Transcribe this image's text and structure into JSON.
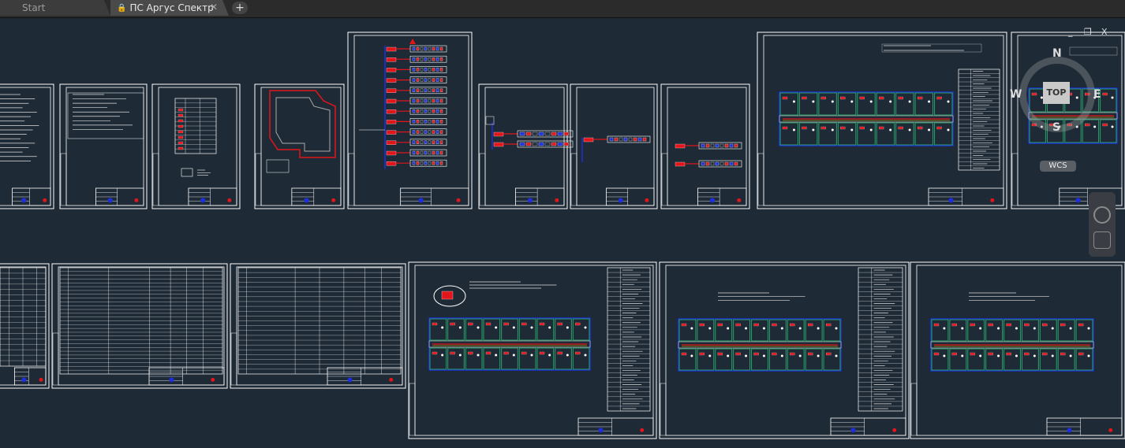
{
  "tabs": [
    {
      "label": "Start",
      "active": false
    },
    {
      "label": "ПС Аргус Спектр",
      "active": true
    }
  ],
  "new_tab_label": "+",
  "window_controls": {
    "minimize": "_",
    "restore": "❐",
    "close": "X"
  },
  "viewcube": {
    "face": "TOP",
    "north": "N",
    "south": "S",
    "east": "E",
    "west": "W"
  },
  "ucs_label": "WCS",
  "colors": {
    "background": "#1e2a36",
    "sheet": "#ffffff",
    "wire_red": "#e0161b",
    "wire_blue": "#1d2fe0",
    "room_green": "#29a06a"
  }
}
